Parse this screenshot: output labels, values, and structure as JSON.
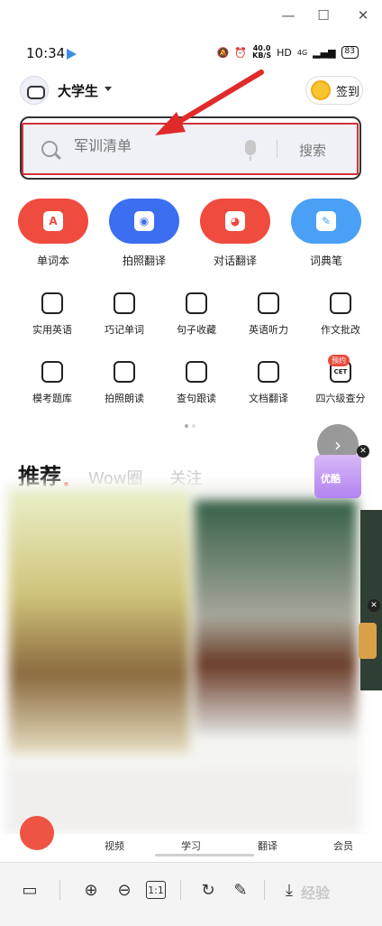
{
  "window": {
    "minimize": "—",
    "maximize": "☐",
    "close": "✕"
  },
  "status_bar": {
    "time": "10:34",
    "net_speed_top": "40.0",
    "net_speed_bottom": "KB/S",
    "hd": "HD",
    "signal": "4G",
    "battery": "83"
  },
  "header": {
    "user_name": "大学生",
    "signin_label": "签到"
  },
  "search": {
    "placeholder": "军训清单",
    "button": "搜索"
  },
  "features": [
    {
      "label": "单词本",
      "color": "#ef4b3f",
      "icon_text": "A"
    },
    {
      "label": "拍照翻译",
      "color": "#3b6ef0",
      "icon_text": "◉"
    },
    {
      "label": "对话翻译",
      "color": "#ef4b3f",
      "icon_text": "◕"
    },
    {
      "label": "词典笔",
      "color": "#4aa0f5",
      "icon_text": "✎"
    }
  ],
  "tools_row1": [
    {
      "label": "实用英语",
      "icon": "a-chat-icon"
    },
    {
      "label": "巧记单词",
      "icon": "y-card-icon"
    },
    {
      "label": "句子收藏",
      "icon": "book-icon"
    },
    {
      "label": "英语听力",
      "icon": "radio-icon"
    },
    {
      "label": "作文批改",
      "icon": "feather-icon"
    }
  ],
  "tools_row2": [
    {
      "label": "模考题库",
      "icon": "checklist-icon"
    },
    {
      "label": "拍照朗读",
      "icon": "camera-read-icon"
    },
    {
      "label": "查句跟读",
      "icon": "tag-icon"
    },
    {
      "label": "文档翻译",
      "icon": "document-icon"
    },
    {
      "label": "四六级查分",
      "icon": "cet-icon"
    }
  ],
  "cet_badge": "预约",
  "cet_icon_text": "CET",
  "tabs": {
    "active": "推荐",
    "second": "Wow圈",
    "third": "关注"
  },
  "promo": {
    "label": "优酷",
    "close": "✕"
  },
  "bottom_nav": {
    "items": [
      "视频",
      "学习",
      "翻译",
      "会员"
    ]
  },
  "viewer_toolbar": {
    "fit_label": "1:1",
    "watermark": "经验"
  }
}
